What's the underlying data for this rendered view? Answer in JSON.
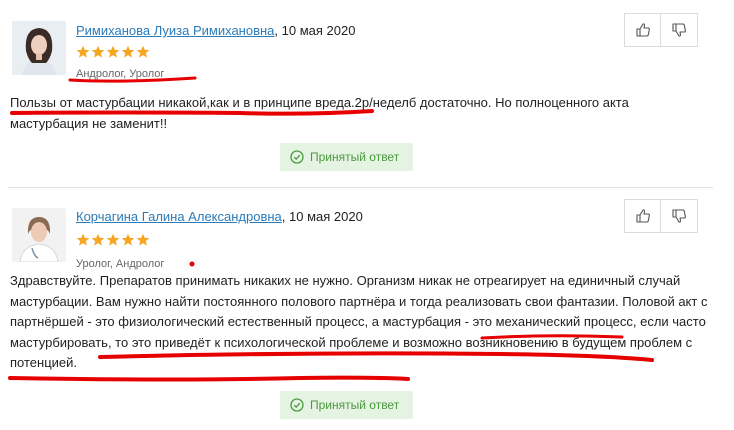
{
  "answers": [
    {
      "doctor_name": "Римиханова Луиза Римихановна",
      "date": ", 10 мая 2020",
      "rating": 5,
      "specialty": "Андролог, Уролог",
      "text": "Пользы от мастурбации никакой,как и в принципе вреда.2р/неделб достаточно. Но полноценного акта мастурбация не заменит!!",
      "accepted_label": "Принятый ответ"
    },
    {
      "doctor_name": "Корчагина Галина Александровна",
      "date": ", 10 мая 2020",
      "rating": 5,
      "specialty": "Уролог, Андролог",
      "text": "Здравствуйте. Препаратов принимать никаких не нужно. Организм никак не отреагирует на единичный случай мастурбации. Вам нужно найти постоянного полового партнёра и тогда реализовать свои фантазии. Половой акт с партнёршей - это физиологический естественный процесс, а мастурбация - это механический процесс, если часто мастурбировать, то это приведёт к психологической проблеме и возможно возникновению в будущем проблем с потенцией.",
      "accepted_label": "Принятый ответ"
    }
  ],
  "colors": {
    "star": "#f5a623",
    "link": "#2b7bb9",
    "accepted_bg": "#e5f3e2",
    "accepted_text": "#4a9a3e",
    "annotation": "#e60000"
  },
  "icons": {
    "like": "thumb-up-icon",
    "dislike": "thumb-down-icon",
    "accepted": "check-circle-icon"
  }
}
